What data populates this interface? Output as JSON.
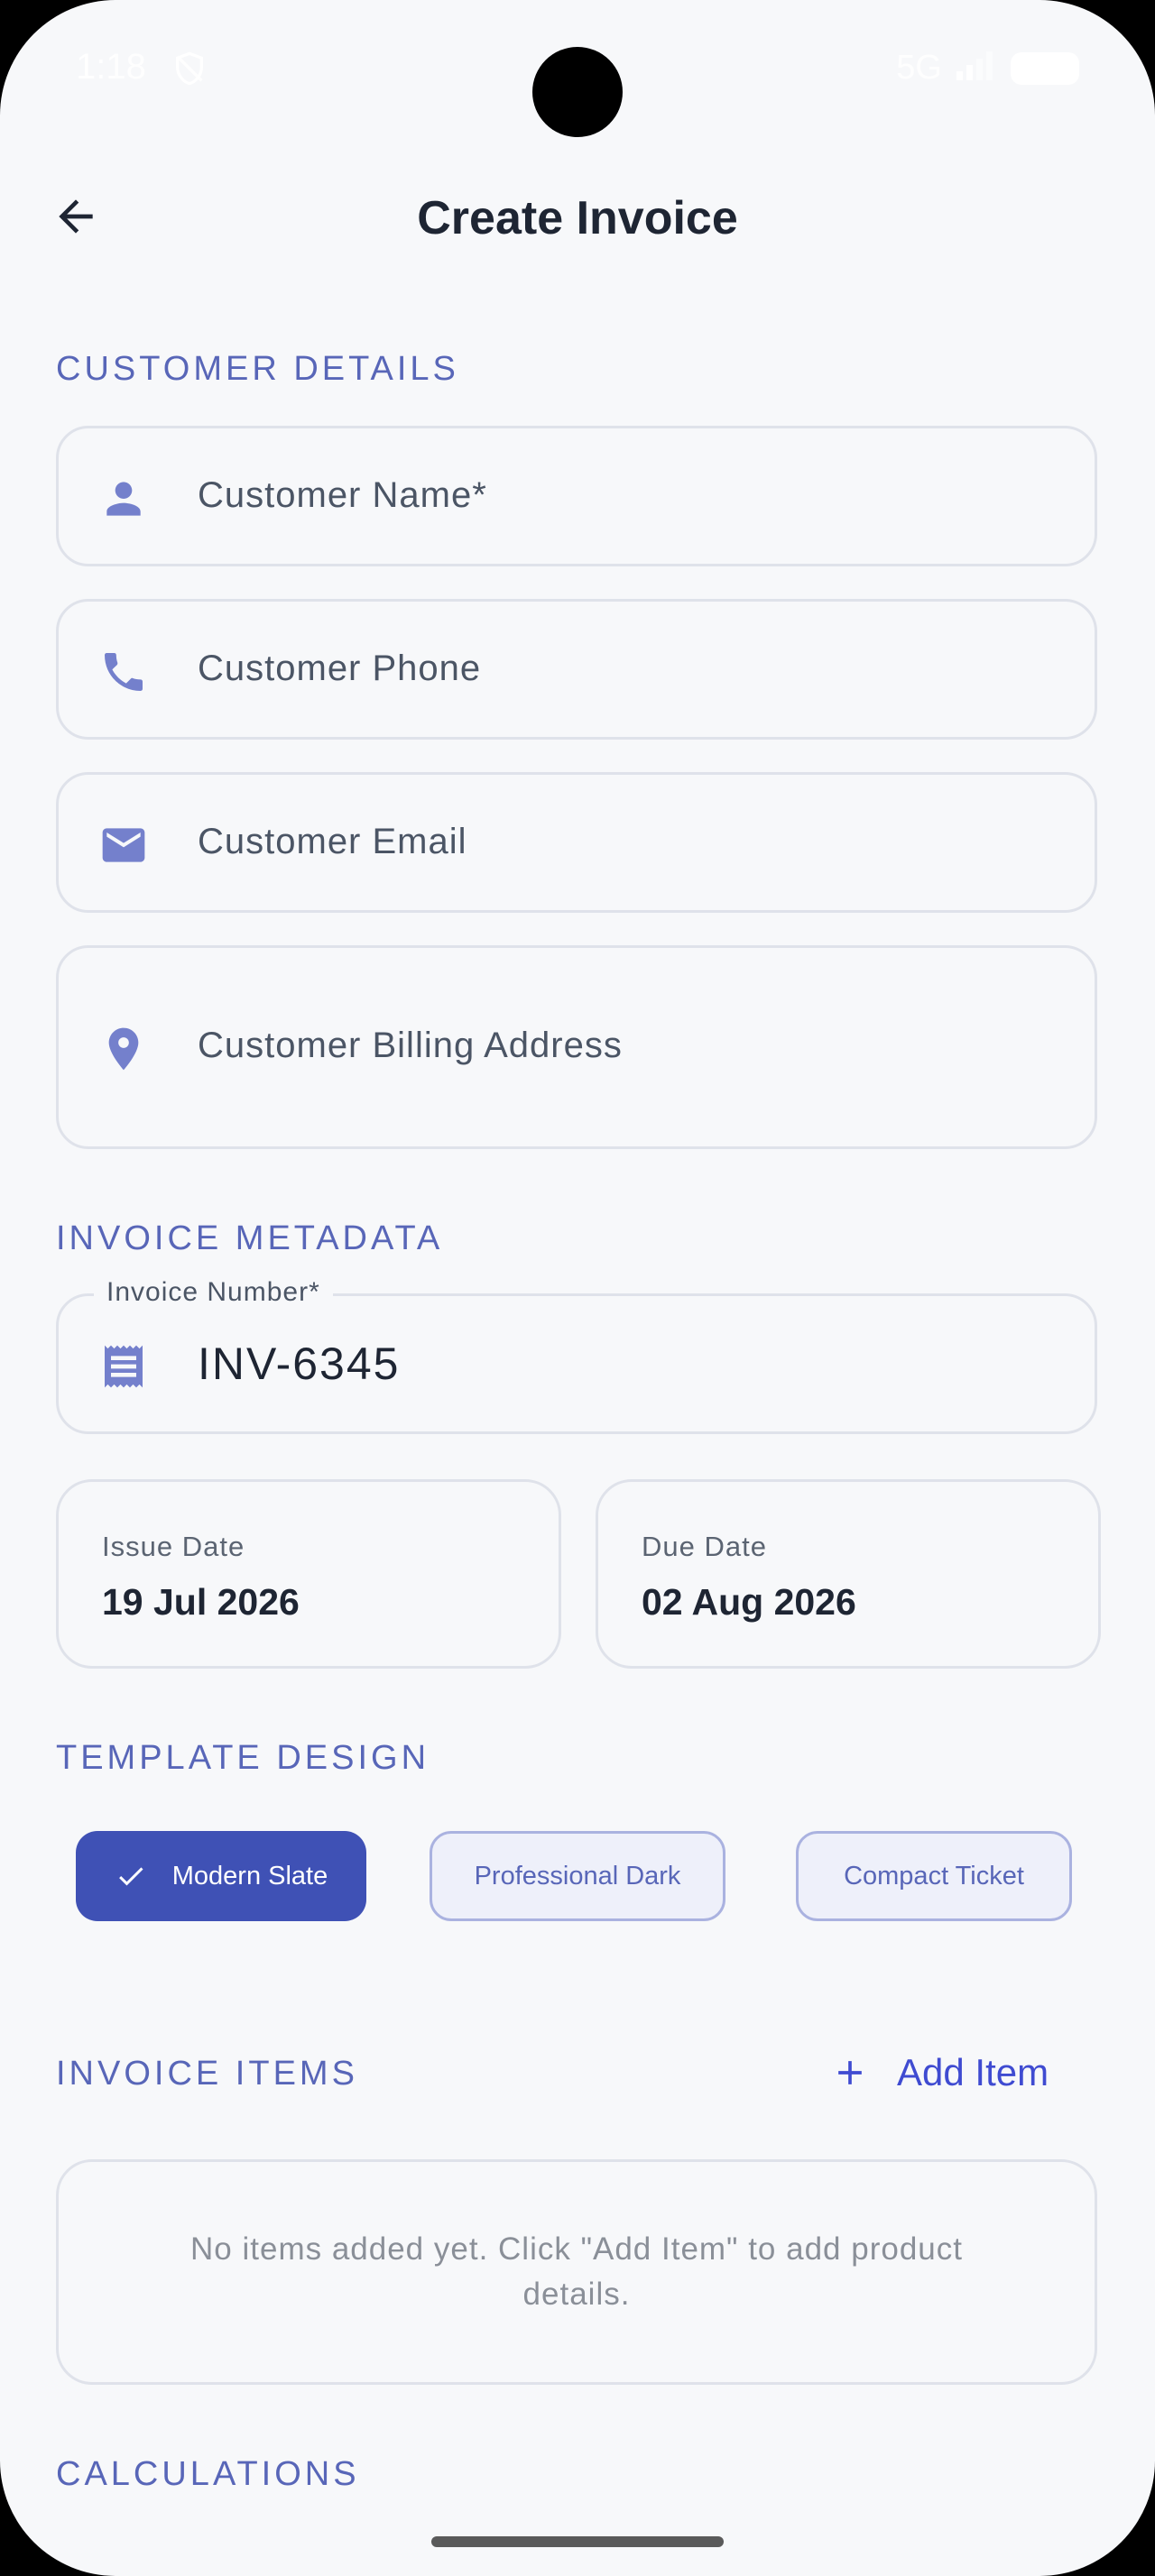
{
  "status": {
    "time": "1:18",
    "network": "5G"
  },
  "app_bar": {
    "title": "Create Invoice"
  },
  "sections": {
    "customer_details": "CUSTOMER DETAILS",
    "invoice_metadata": "INVOICE METADATA",
    "template_design": "TEMPLATE DESIGN",
    "invoice_items": "INVOICE ITEMS",
    "calculations": "CALCULATIONS"
  },
  "customer": {
    "name_placeholder": "Customer Name*",
    "phone_placeholder": "Customer Phone",
    "email_placeholder": "Customer Email",
    "address_placeholder": "Customer Billing Address"
  },
  "metadata": {
    "invoice_number_label": "Invoice Number*",
    "invoice_number_value": "INV-6345",
    "issue_date_label": "Issue Date",
    "issue_date_value": "19 Jul 2026",
    "due_date_label": "Due Date",
    "due_date_value": "02 Aug 2026"
  },
  "templates": [
    {
      "label": "Modern Slate",
      "selected": true
    },
    {
      "label": "Professional Dark",
      "selected": false
    },
    {
      "label": "Compact Ticket",
      "selected": false
    }
  ],
  "items": {
    "add_label": "Add Item",
    "empty_message": "No items added yet. Click \"Add Item\" to add product details."
  },
  "colors": {
    "accent": "#3f51b5",
    "section_label": "#5866b8",
    "icon": "#7480cc",
    "background": "#f7f8fa",
    "title": "#1e2533"
  },
  "icons": {
    "back": "arrow-left-icon",
    "name": "person-icon",
    "phone": "phone-icon",
    "email": "mail-icon",
    "address": "location-pin-icon",
    "invoice_number": "receipt-icon",
    "template_selected": "check-icon",
    "add_item": "plus-icon"
  }
}
